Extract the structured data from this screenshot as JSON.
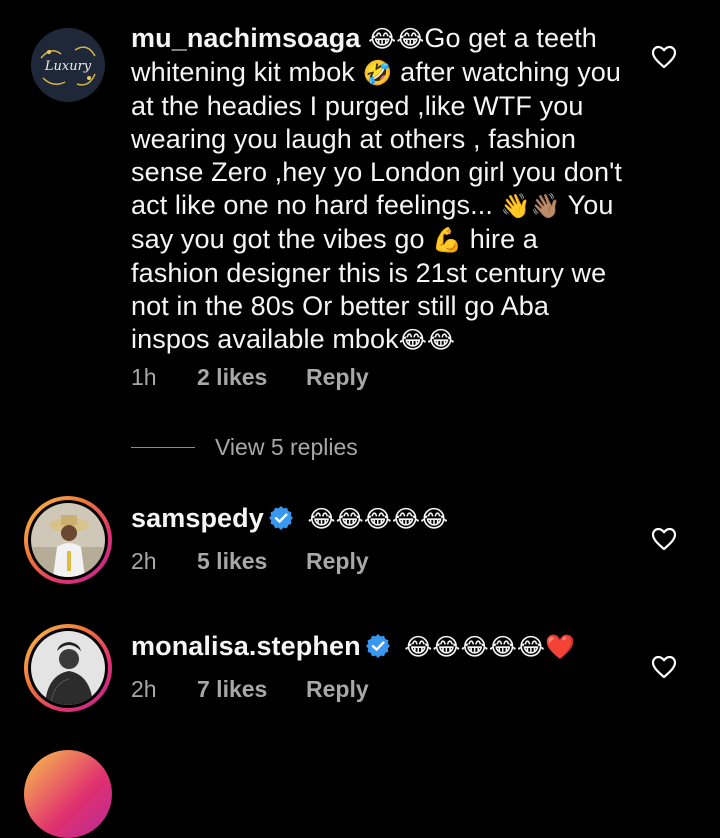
{
  "comments": [
    {
      "username": "mu_nachimsoaga",
      "segments": [
        {
          "t": "emoji",
          "v": "😂😂"
        },
        {
          "t": "text",
          "v": "Go get a teeth whitening kit  mbok "
        },
        {
          "t": "emoji",
          "v": "🤣"
        },
        {
          "t": "text",
          "v": " after watching you at the headies I purged ,like WTF you wearing you laugh at others , fashion sense Zero ,hey yo London girl you don't act like one no hard feelings... "
        },
        {
          "t": "emoji",
          "v": "👋👋🏽"
        },
        {
          "t": "text",
          "v": " You say you got the vibes go "
        },
        {
          "t": "emoji",
          "v": "💪"
        },
        {
          "t": "text",
          "v": " hire a fashion designer this is 21st century we not in the 80s Or better still go Aba inspos available mbok"
        },
        {
          "t": "emoji",
          "v": "😂😂"
        }
      ],
      "time": "1h",
      "likes": "2 likes",
      "reply_label": "Reply",
      "verified": false,
      "avatar_icon": "luxury-logo-avatar",
      "avatar_text": "Luxury"
    },
    {
      "username": "samspedy",
      "segments": [
        {
          "t": "emoji",
          "v": "😂😂😂😂😂"
        }
      ],
      "time": "2h",
      "likes": "5 likes",
      "reply_label": "Reply",
      "verified": true
    },
    {
      "username": "monalisa.stephen",
      "segments": [
        {
          "t": "emoji",
          "v": "😂😂😂😂😂❤️"
        }
      ],
      "time": "2h",
      "likes": "7 likes",
      "reply_label": "Reply",
      "verified": true
    }
  ],
  "view_replies": "View 5 replies",
  "colors": {
    "background": "#000000",
    "text": "#f5f5f5",
    "muted": "#a8a8a8",
    "verified_blue": "#3897f0",
    "story_ring": [
      "#f9c44a",
      "#f2703a",
      "#e0306f",
      "#b62a98"
    ]
  },
  "icons": [
    "heart-outline-icon",
    "verified-badge-icon"
  ]
}
